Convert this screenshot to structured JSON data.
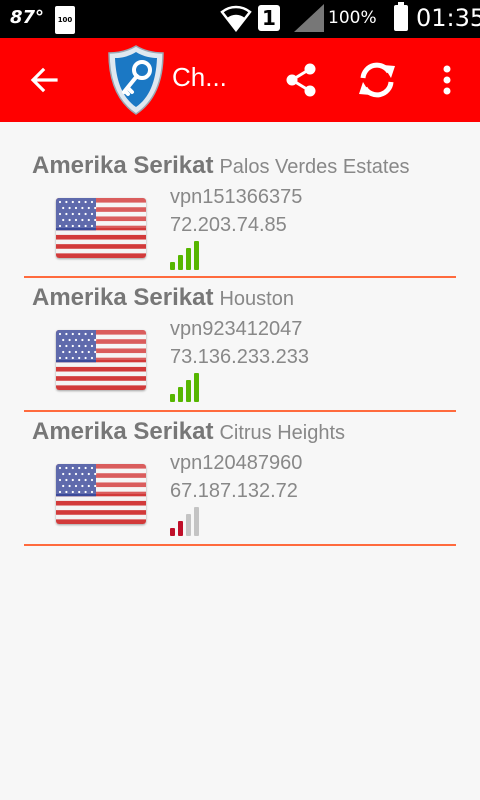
{
  "status_bar": {
    "temperature": "87°",
    "battery_small": "100",
    "sim_slot": "1",
    "battery_percent": "100%",
    "time": "01:35"
  },
  "app_bar": {
    "title": "Ch...",
    "color": "#ff0000",
    "icons": [
      "back-arrow-icon",
      "shield-key-logo",
      "share-icon",
      "sync-icon",
      "more-vert-icon"
    ]
  },
  "servers": [
    {
      "country": "Amerika Serikat",
      "city": "Palos Verdes Estates",
      "host": "vpn151366375",
      "ip": "72.203.74.85",
      "signal_level": 4,
      "signal_color": "#56b600"
    },
    {
      "country": "Amerika Serikat",
      "city": "Houston",
      "host": "vpn923412047",
      "ip": "73.136.233.233",
      "signal_level": 4,
      "signal_color": "#56b600"
    },
    {
      "country": "Amerika Serikat",
      "city": "Citrus Heights",
      "host": "vpn120487960",
      "ip": "67.187.132.72",
      "signal_level": 2,
      "signal_color": "#c0102a"
    }
  ]
}
